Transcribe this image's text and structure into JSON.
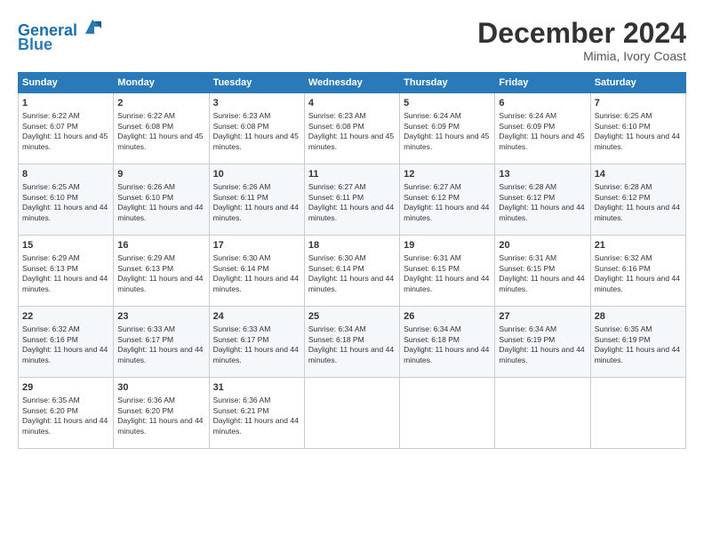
{
  "header": {
    "logo_line1": "General",
    "logo_line2": "Blue",
    "month_title": "December 2024",
    "location": "Mimia, Ivory Coast"
  },
  "weekdays": [
    "Sunday",
    "Monday",
    "Tuesday",
    "Wednesday",
    "Thursday",
    "Friday",
    "Saturday"
  ],
  "weeks": [
    [
      {
        "day": "1",
        "sunrise": "6:22 AM",
        "sunset": "6:07 PM",
        "daylight": "11 hours and 45 minutes."
      },
      {
        "day": "2",
        "sunrise": "6:22 AM",
        "sunset": "6:08 PM",
        "daylight": "11 hours and 45 minutes."
      },
      {
        "day": "3",
        "sunrise": "6:23 AM",
        "sunset": "6:08 PM",
        "daylight": "11 hours and 45 minutes."
      },
      {
        "day": "4",
        "sunrise": "6:23 AM",
        "sunset": "6:08 PM",
        "daylight": "11 hours and 45 minutes."
      },
      {
        "day": "5",
        "sunrise": "6:24 AM",
        "sunset": "6:09 PM",
        "daylight": "11 hours and 45 minutes."
      },
      {
        "day": "6",
        "sunrise": "6:24 AM",
        "sunset": "6:09 PM",
        "daylight": "11 hours and 45 minutes."
      },
      {
        "day": "7",
        "sunrise": "6:25 AM",
        "sunset": "6:10 PM",
        "daylight": "11 hours and 44 minutes."
      }
    ],
    [
      {
        "day": "8",
        "sunrise": "6:25 AM",
        "sunset": "6:10 PM",
        "daylight": "11 hours and 44 minutes."
      },
      {
        "day": "9",
        "sunrise": "6:26 AM",
        "sunset": "6:10 PM",
        "daylight": "11 hours and 44 minutes."
      },
      {
        "day": "10",
        "sunrise": "6:26 AM",
        "sunset": "6:11 PM",
        "daylight": "11 hours and 44 minutes."
      },
      {
        "day": "11",
        "sunrise": "6:27 AM",
        "sunset": "6:11 PM",
        "daylight": "11 hours and 44 minutes."
      },
      {
        "day": "12",
        "sunrise": "6:27 AM",
        "sunset": "6:12 PM",
        "daylight": "11 hours and 44 minutes."
      },
      {
        "day": "13",
        "sunrise": "6:28 AM",
        "sunset": "6:12 PM",
        "daylight": "11 hours and 44 minutes."
      },
      {
        "day": "14",
        "sunrise": "6:28 AM",
        "sunset": "6:12 PM",
        "daylight": "11 hours and 44 minutes."
      }
    ],
    [
      {
        "day": "15",
        "sunrise": "6:29 AM",
        "sunset": "6:13 PM",
        "daylight": "11 hours and 44 minutes."
      },
      {
        "day": "16",
        "sunrise": "6:29 AM",
        "sunset": "6:13 PM",
        "daylight": "11 hours and 44 minutes."
      },
      {
        "day": "17",
        "sunrise": "6:30 AM",
        "sunset": "6:14 PM",
        "daylight": "11 hours and 44 minutes."
      },
      {
        "day": "18",
        "sunrise": "6:30 AM",
        "sunset": "6:14 PM",
        "daylight": "11 hours and 44 minutes."
      },
      {
        "day": "19",
        "sunrise": "6:31 AM",
        "sunset": "6:15 PM",
        "daylight": "11 hours and 44 minutes."
      },
      {
        "day": "20",
        "sunrise": "6:31 AM",
        "sunset": "6:15 PM",
        "daylight": "11 hours and 44 minutes."
      },
      {
        "day": "21",
        "sunrise": "6:32 AM",
        "sunset": "6:16 PM",
        "daylight": "11 hours and 44 minutes."
      }
    ],
    [
      {
        "day": "22",
        "sunrise": "6:32 AM",
        "sunset": "6:16 PM",
        "daylight": "11 hours and 44 minutes."
      },
      {
        "day": "23",
        "sunrise": "6:33 AM",
        "sunset": "6:17 PM",
        "daylight": "11 hours and 44 minutes."
      },
      {
        "day": "24",
        "sunrise": "6:33 AM",
        "sunset": "6:17 PM",
        "daylight": "11 hours and 44 minutes."
      },
      {
        "day": "25",
        "sunrise": "6:34 AM",
        "sunset": "6:18 PM",
        "daylight": "11 hours and 44 minutes."
      },
      {
        "day": "26",
        "sunrise": "6:34 AM",
        "sunset": "6:18 PM",
        "daylight": "11 hours and 44 minutes."
      },
      {
        "day": "27",
        "sunrise": "6:34 AM",
        "sunset": "6:19 PM",
        "daylight": "11 hours and 44 minutes."
      },
      {
        "day": "28",
        "sunrise": "6:35 AM",
        "sunset": "6:19 PM",
        "daylight": "11 hours and 44 minutes."
      }
    ],
    [
      {
        "day": "29",
        "sunrise": "6:35 AM",
        "sunset": "6:20 PM",
        "daylight": "11 hours and 44 minutes."
      },
      {
        "day": "30",
        "sunrise": "6:36 AM",
        "sunset": "6:20 PM",
        "daylight": "11 hours and 44 minutes."
      },
      {
        "day": "31",
        "sunrise": "6:36 AM",
        "sunset": "6:21 PM",
        "daylight": "11 hours and 44 minutes."
      },
      null,
      null,
      null,
      null
    ]
  ]
}
